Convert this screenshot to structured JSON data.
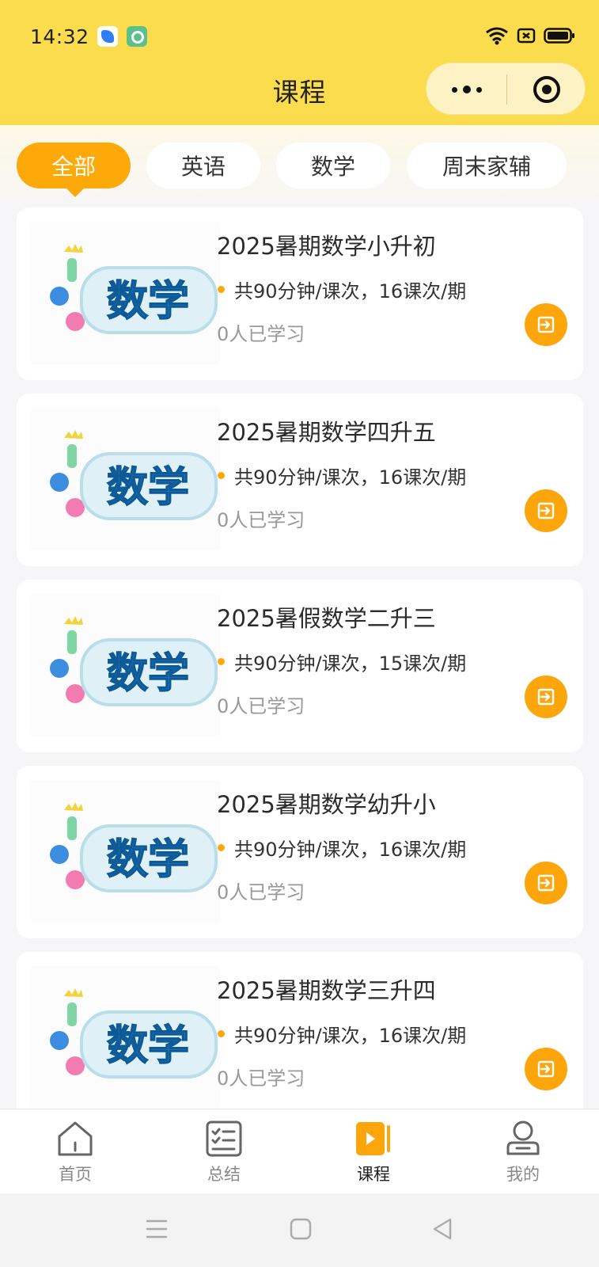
{
  "status_bar": {
    "time": "14:32",
    "icons": [
      "app-blue-icon",
      "app-green-icon",
      "wifi-icon",
      "sim-icon",
      "battery-icon"
    ]
  },
  "nav": {
    "title": "课程",
    "capsule_icons": [
      "more-dots-icon",
      "close-target-icon"
    ]
  },
  "filter_tabs": [
    {
      "label": "全部",
      "active": true
    },
    {
      "label": "英语",
      "active": false
    },
    {
      "label": "数学",
      "active": false
    },
    {
      "label": "周末家辅",
      "active": false
    }
  ],
  "courses": [
    {
      "title": "2025暑期数学小升初",
      "meta": "共90分钟/课次，16课次/期",
      "learners": "0人已学习",
      "cover_text": "数学"
    },
    {
      "title": "2025暑期数学四升五",
      "meta": "共90分钟/课次，16课次/期",
      "learners": "0人已学习",
      "cover_text": "数学"
    },
    {
      "title": "2025暑假数学二升三",
      "meta": "共90分钟/课次，15课次/期",
      "learners": "0人已学习",
      "cover_text": "数学"
    },
    {
      "title": "2025暑期数学幼升小",
      "meta": "共90分钟/课次，16课次/期",
      "learners": "0人已学习",
      "cover_text": "数学"
    },
    {
      "title": "2025暑期数学三升四",
      "meta": "共90分钟/课次，16课次/期",
      "learners": "0人已学习",
      "cover_text": "数学"
    }
  ],
  "tabbar": [
    {
      "label": "首页",
      "icon": "home-icon",
      "active": false
    },
    {
      "label": "总结",
      "icon": "summary-icon",
      "active": false
    },
    {
      "label": "课程",
      "icon": "course-play-icon",
      "active": true
    },
    {
      "label": "我的",
      "icon": "profile-icon",
      "active": false
    }
  ],
  "colors": {
    "header": "#fbdc4d",
    "accent": "#fca60b",
    "background": "#f6f6f8"
  }
}
